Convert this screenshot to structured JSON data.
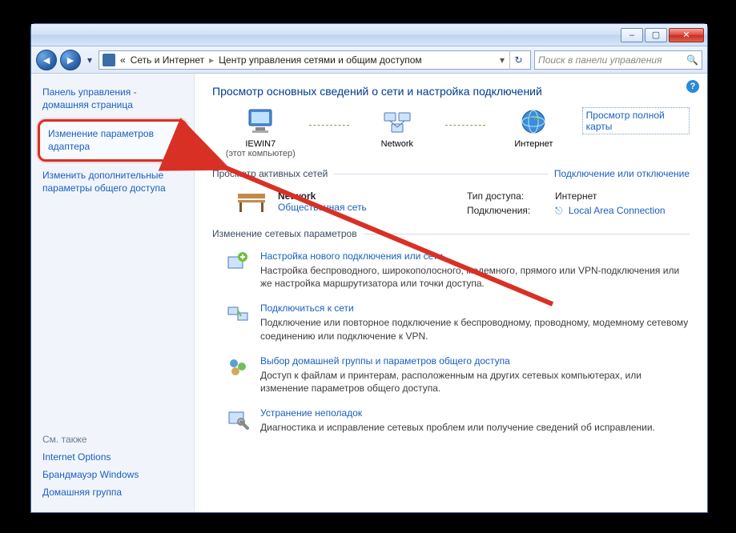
{
  "titlebar": {
    "minimize": "–",
    "maximize": "▢",
    "close": "✕"
  },
  "nav": {
    "back": "◄",
    "forward": "►",
    "dropdown": "▾",
    "refresh": "↻"
  },
  "address": {
    "prefix": "«",
    "crumb1": "Сеть и Интернет",
    "sep": "▸",
    "crumb2": "Центр управления сетями и общим доступом",
    "dd": "▾"
  },
  "search": {
    "placeholder": "Поиск в панели управления",
    "icon": "🔍"
  },
  "sidebar": {
    "cp_home": "Панель управления - домашняя страница",
    "adapter": "Изменение параметров адаптера",
    "sharing": "Изменить дополнительные параметры общего доступа",
    "see_also": "См. также",
    "links": {
      "inetopt": "Internet Options",
      "firewall": "Брандмауэр Windows",
      "homegroup": "Домашняя группа"
    }
  },
  "content": {
    "help": "?",
    "title": "Просмотр основных сведений о сети и настройка подключений",
    "map": {
      "node1": "IEWIN7",
      "node1_sub": "(этот компьютер)",
      "node2": "Network",
      "node3": "Интернет",
      "full_map": "Просмотр полной карты"
    },
    "active_nets_head": "Просмотр активных сетей",
    "connect_disconnect": "Подключение или отключение",
    "network": {
      "name": "Network",
      "type": "Общественная сеть",
      "access_label": "Тип доступа:",
      "access_value": "Интернет",
      "conn_label": "Подключения:",
      "conn_value": "Local Area Connection"
    },
    "change_head": "Изменение сетевых параметров",
    "tasks": [
      {
        "title": "Настройка нового подключения или сети",
        "desc": "Настройка беспроводного, широкополосного, модемного, прямого или VPN-подключения или же настройка маршрутизатора или точки доступа."
      },
      {
        "title": "Подключиться к сети",
        "desc": "Подключение или повторное подключение к беспроводному, проводному, модемному сетевому соединению или подключение к VPN."
      },
      {
        "title": "Выбор домашней группы и параметров общего доступа",
        "desc": "Доступ к файлам и принтерам, расположенным на других сетевых компьютерах, или изменение параметров общего доступа."
      },
      {
        "title": "Устранение неполадок",
        "desc": "Диагностика и исправление сетевых проблем или получение сведений об исправлении."
      }
    ]
  }
}
